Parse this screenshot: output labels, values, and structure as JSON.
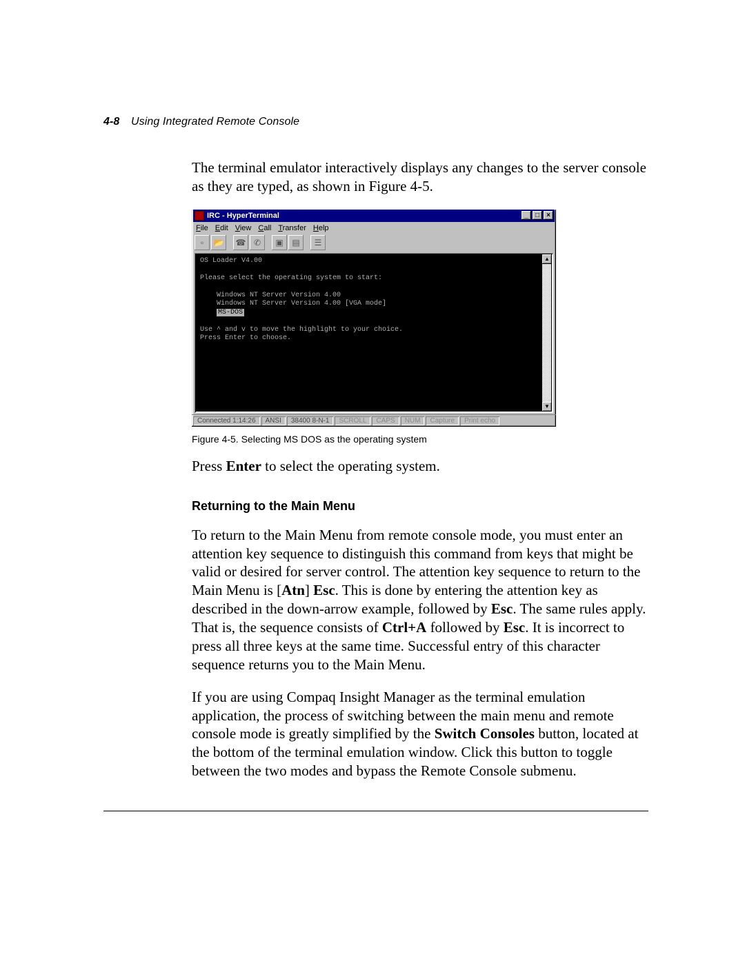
{
  "header": {
    "page_num": "4-8",
    "section": "Using Integrated Remote Console"
  },
  "intro_para": "The terminal emulator interactively displays any changes to the server console as they are typed, as shown in Figure 4-5.",
  "figure": {
    "window_title": "IRC - HyperTerminal",
    "menubar": {
      "file": "File",
      "edit": "Edit",
      "view": "View",
      "call": "Call",
      "transfer": "Transfer",
      "help": "Help"
    },
    "terminal": {
      "line1": "OS Loader V4.00",
      "line2": "Please select the operating system to start:",
      "opt1": "Windows NT Server Version 4.00",
      "opt2": "Windows NT Server Version 4.00 [VGA mode]",
      "opt3_selected": "MS-DOS",
      "hint1": "Use ^ and v to move the highlight to your choice.",
      "hint2": "Press Enter to choose."
    },
    "statusbar": {
      "connected": "Connected 1:14:26",
      "emul": "ANSI",
      "line": "38400 8-N-1",
      "scroll": "SCROLL",
      "caps": "CAPS",
      "num": "NUM",
      "capture": "Capture",
      "print": "Print echo"
    },
    "caption": "Figure 4-5.    Selecting MS DOS as the operating system"
  },
  "press_enter": {
    "pre": "Press ",
    "bold": "Enter",
    "post": " to select the operating system."
  },
  "subhead": "Returning to the Main Menu",
  "para2": {
    "t1": "To return to the Main Menu from remote console mode, you must enter an attention key sequence to distinguish this command from keys that might be valid or desired for server control. The attention key sequence to return to the Main Menu is [",
    "b1": "Atn",
    "t2": "] ",
    "b2": "Esc",
    "t3": ". This is done by entering the attention key as described in the down-arrow example, followed by ",
    "b3": "Esc",
    "t4": ". The same rules apply. That is, the sequence consists of ",
    "b4": "Ctrl+A",
    "t5": " followed by ",
    "b5": "Esc",
    "t6": ". It is incorrect to press all three keys at the same time. Successful entry of this character sequence returns you to the Main Menu."
  },
  "para3": {
    "t1": "If you are using Compaq Insight Manager as the terminal emulation application, the process of switching between the main menu and remote console mode is greatly simplified by the ",
    "b1": "Switch Consoles",
    "t2": " button, located at the bottom of the terminal emulation window. Click this button to toggle between the two modes and bypass the Remote Console submenu."
  }
}
